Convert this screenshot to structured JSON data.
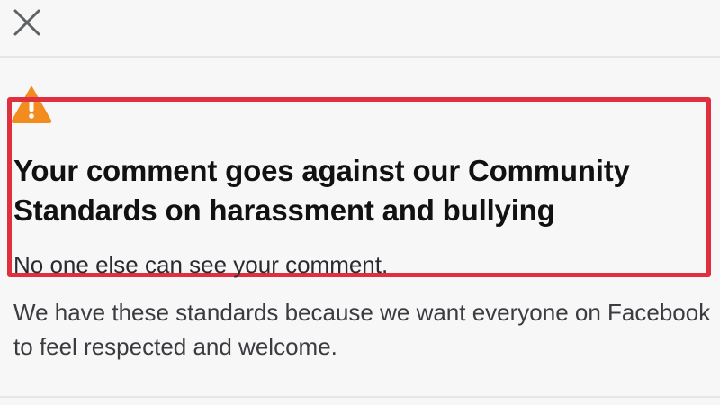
{
  "dialog": {
    "close_icon": "close-icon",
    "warning_icon": "warning-triangle-icon",
    "title": "Your comment goes against our Community Standards on harassment and bullying",
    "subtitle": "No one else can see your comment.",
    "body": "We have these standards because we want everyone on Facebook to feel respected and welcome."
  },
  "colors": {
    "warning": "#f28c1f",
    "highlight": "#e0303f",
    "background": "#f7f7f8"
  }
}
